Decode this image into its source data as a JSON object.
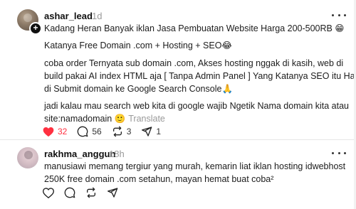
{
  "post": {
    "author": "ashar_lead",
    "time": "1d",
    "paragraphs": [
      "Kadang Heran Banyak iklan Jasa Pembuatan Website Harga 200-500RB 😁",
      "Katanya Free Domain .com + Hosting + SEO😂",
      "coba order Ternyata sub domain .com, Akses hosting nggak di kasih, web di",
      "build pakai AI index HTML aja [ Tanpa Admin Panel ] Yang Katanya SEO itu Hanya",
      "di Submit domain ke Google Search Console🙏",
      "jadi kalau mau search web kita di google wajib Ngetik Nama domain kita atau",
      "site:namadomain 🙂"
    ],
    "translate_label": "Translate",
    "actions": {
      "likes": "32",
      "comments": "56",
      "reposts": "3",
      "shares": "1"
    }
  },
  "reply": {
    "author": "rakhma_anggun",
    "time": "18h",
    "paragraphs": [
      "manusiawi memang tergiur yang murah, kemarin liat iklan hosting idwebhost",
      "250K free domain .com setahun, mayan hemat buat coba²"
    ]
  },
  "colors": {
    "like_red": "#ff3040",
    "muted_gray": "#999999",
    "text_dark": "#1c1c1c"
  },
  "icons": [
    "heart-icon",
    "comment-icon",
    "repost-icon",
    "share-icon",
    "more-icon",
    "add-follow-icon"
  ]
}
